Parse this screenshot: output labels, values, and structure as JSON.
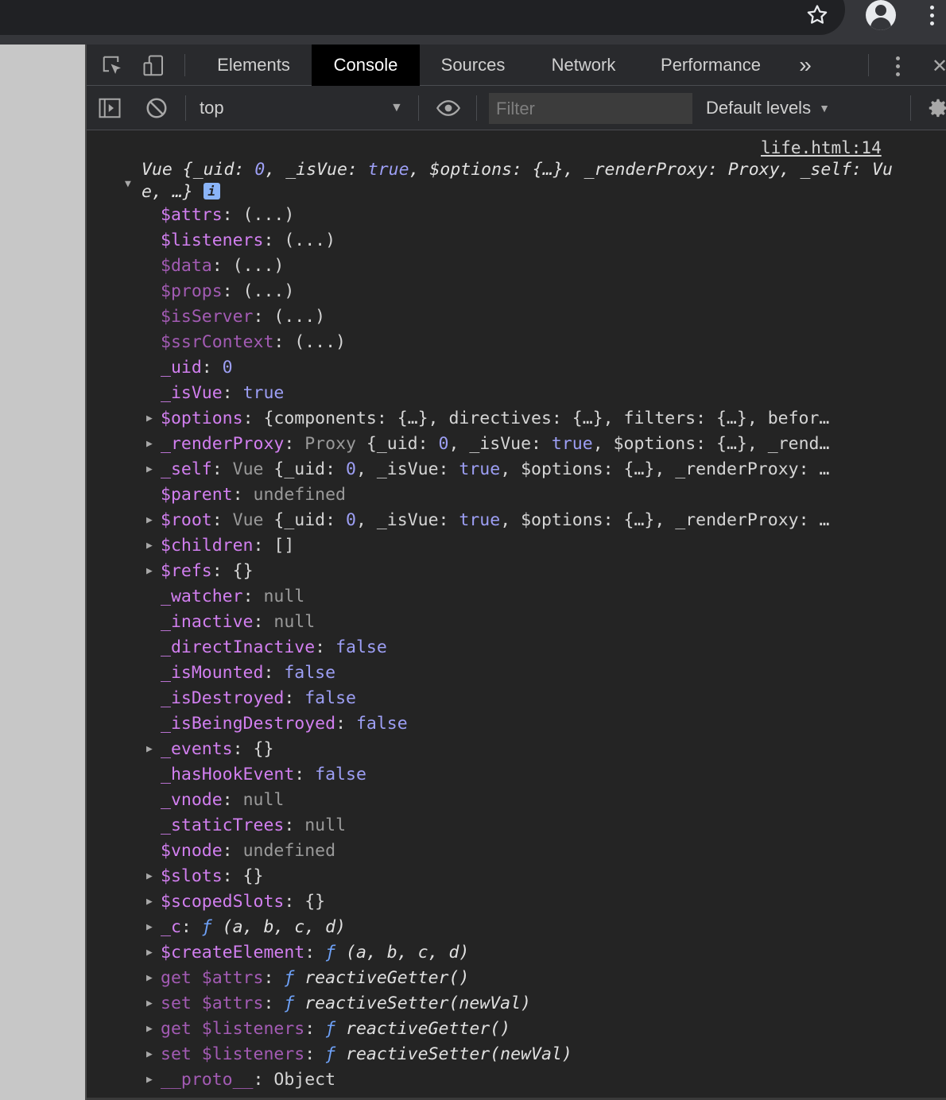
{
  "devtools": {
    "tabs": [
      {
        "label": "Elements",
        "selected": false
      },
      {
        "label": "Console",
        "selected": true
      },
      {
        "label": "Sources",
        "selected": false
      },
      {
        "label": "Network",
        "selected": false
      },
      {
        "label": "Performance",
        "selected": false
      }
    ],
    "more_tabs": "»",
    "close": "✕"
  },
  "toolbar": {
    "context": "top",
    "filter_placeholder": "Filter",
    "levels": "Default levels"
  },
  "console": {
    "source": "life.html:14",
    "summary": {
      "parts": [
        {
          "t": "Vue {_uid: ",
          "c": "fi"
        },
        {
          "t": "0",
          "c": "n"
        },
        {
          "t": ", _isVue: ",
          "c": "fi"
        },
        {
          "t": "true",
          "c": "b"
        },
        {
          "t": ", $options: {…}, _renderProxy: Proxy, _self: Vue, …}",
          "c": "fi"
        }
      ],
      "badge": "i"
    },
    "rows": [
      {
        "exp": false,
        "parts": [
          {
            "t": "$attrs",
            "c": "k"
          },
          {
            "t": ": (...)",
            "c": "c"
          }
        ]
      },
      {
        "exp": false,
        "parts": [
          {
            "t": "$listeners",
            "c": "k"
          },
          {
            "t": ": (...)",
            "c": "c"
          }
        ]
      },
      {
        "exp": false,
        "parts": [
          {
            "t": "$data",
            "c": "k dim"
          },
          {
            "t": ": (...)",
            "c": "c"
          }
        ]
      },
      {
        "exp": false,
        "parts": [
          {
            "t": "$props",
            "c": "k dim"
          },
          {
            "t": ": (...)",
            "c": "c"
          }
        ]
      },
      {
        "exp": false,
        "parts": [
          {
            "t": "$isServer",
            "c": "k dim"
          },
          {
            "t": ": (...)",
            "c": "c"
          }
        ]
      },
      {
        "exp": false,
        "parts": [
          {
            "t": "$ssrContext",
            "c": "k dim"
          },
          {
            "t": ": (...)",
            "c": "c"
          }
        ]
      },
      {
        "exp": false,
        "parts": [
          {
            "t": "_uid",
            "c": "k"
          },
          {
            "t": ": ",
            "c": "c"
          },
          {
            "t": "0",
            "c": "n"
          }
        ]
      },
      {
        "exp": false,
        "parts": [
          {
            "t": "_isVue",
            "c": "k"
          },
          {
            "t": ": ",
            "c": "c"
          },
          {
            "t": "true",
            "c": "b"
          }
        ]
      },
      {
        "exp": true,
        "parts": [
          {
            "t": "$options",
            "c": "k"
          },
          {
            "t": ": {components: {…}, directives: {…}, filters: {…}, befor…",
            "c": "c"
          }
        ]
      },
      {
        "exp": true,
        "parts": [
          {
            "t": "_renderProxy",
            "c": "k"
          },
          {
            "t": ": ",
            "c": "c"
          },
          {
            "t": "Proxy ",
            "c": "g"
          },
          {
            "t": "{_uid: ",
            "c": "c"
          },
          {
            "t": "0",
            "c": "n"
          },
          {
            "t": ", _isVue: ",
            "c": "c"
          },
          {
            "t": "true",
            "c": "b"
          },
          {
            "t": ", $options: {…}, _rend…",
            "c": "c"
          }
        ]
      },
      {
        "exp": true,
        "parts": [
          {
            "t": "_self",
            "c": "k"
          },
          {
            "t": ": ",
            "c": "c"
          },
          {
            "t": "Vue ",
            "c": "g"
          },
          {
            "t": "{_uid: ",
            "c": "c"
          },
          {
            "t": "0",
            "c": "n"
          },
          {
            "t": ", _isVue: ",
            "c": "c"
          },
          {
            "t": "true",
            "c": "b"
          },
          {
            "t": ", $options: {…}, _renderProxy: …",
            "c": "c"
          }
        ]
      },
      {
        "exp": false,
        "parts": [
          {
            "t": "$parent",
            "c": "k"
          },
          {
            "t": ": ",
            "c": "c"
          },
          {
            "t": "undefined",
            "c": "nl"
          }
        ]
      },
      {
        "exp": true,
        "parts": [
          {
            "t": "$root",
            "c": "k"
          },
          {
            "t": ": ",
            "c": "c"
          },
          {
            "t": "Vue ",
            "c": "g"
          },
          {
            "t": "{_uid: ",
            "c": "c"
          },
          {
            "t": "0",
            "c": "n"
          },
          {
            "t": ", _isVue: ",
            "c": "c"
          },
          {
            "t": "true",
            "c": "b"
          },
          {
            "t": ", $options: {…}, _renderProxy: …",
            "c": "c"
          }
        ]
      },
      {
        "exp": true,
        "parts": [
          {
            "t": "$children",
            "c": "k"
          },
          {
            "t": ": []",
            "c": "c"
          }
        ]
      },
      {
        "exp": true,
        "parts": [
          {
            "t": "$refs",
            "c": "k"
          },
          {
            "t": ": {}",
            "c": "c"
          }
        ]
      },
      {
        "exp": false,
        "parts": [
          {
            "t": "_watcher",
            "c": "k"
          },
          {
            "t": ": ",
            "c": "c"
          },
          {
            "t": "null",
            "c": "nl"
          }
        ]
      },
      {
        "exp": false,
        "parts": [
          {
            "t": "_inactive",
            "c": "k"
          },
          {
            "t": ": ",
            "c": "c"
          },
          {
            "t": "null",
            "c": "nl"
          }
        ]
      },
      {
        "exp": false,
        "parts": [
          {
            "t": "_directInactive",
            "c": "k"
          },
          {
            "t": ": ",
            "c": "c"
          },
          {
            "t": "false",
            "c": "b"
          }
        ]
      },
      {
        "exp": false,
        "parts": [
          {
            "t": "_isMounted",
            "c": "k"
          },
          {
            "t": ": ",
            "c": "c"
          },
          {
            "t": "false",
            "c": "b"
          }
        ]
      },
      {
        "exp": false,
        "parts": [
          {
            "t": "_isDestroyed",
            "c": "k"
          },
          {
            "t": ": ",
            "c": "c"
          },
          {
            "t": "false",
            "c": "b"
          }
        ]
      },
      {
        "exp": false,
        "parts": [
          {
            "t": "_isBeingDestroyed",
            "c": "k"
          },
          {
            "t": ": ",
            "c": "c"
          },
          {
            "t": "false",
            "c": "b"
          }
        ]
      },
      {
        "exp": true,
        "parts": [
          {
            "t": "_events",
            "c": "k"
          },
          {
            "t": ": {}",
            "c": "c"
          }
        ]
      },
      {
        "exp": false,
        "parts": [
          {
            "t": "_hasHookEvent",
            "c": "k"
          },
          {
            "t": ": ",
            "c": "c"
          },
          {
            "t": "false",
            "c": "b"
          }
        ]
      },
      {
        "exp": false,
        "parts": [
          {
            "t": "_vnode",
            "c": "k"
          },
          {
            "t": ": ",
            "c": "c"
          },
          {
            "t": "null",
            "c": "nl"
          }
        ]
      },
      {
        "exp": false,
        "parts": [
          {
            "t": "_staticTrees",
            "c": "k"
          },
          {
            "t": ": ",
            "c": "c"
          },
          {
            "t": "null",
            "c": "nl"
          }
        ]
      },
      {
        "exp": false,
        "parts": [
          {
            "t": "$vnode",
            "c": "k"
          },
          {
            "t": ": ",
            "c": "c"
          },
          {
            "t": "undefined",
            "c": "nl"
          }
        ]
      },
      {
        "exp": true,
        "parts": [
          {
            "t": "$slots",
            "c": "k"
          },
          {
            "t": ": {}",
            "c": "c"
          }
        ]
      },
      {
        "exp": true,
        "parts": [
          {
            "t": "$scopedSlots",
            "c": "k"
          },
          {
            "t": ": {}",
            "c": "c"
          }
        ]
      },
      {
        "exp": true,
        "parts": [
          {
            "t": "_c",
            "c": "k"
          },
          {
            "t": ": ",
            "c": "c"
          },
          {
            "t": "ƒ ",
            "c": "f"
          },
          {
            "t": "(a, b, c, d)",
            "c": "fi"
          }
        ]
      },
      {
        "exp": true,
        "parts": [
          {
            "t": "$createElement",
            "c": "k"
          },
          {
            "t": ": ",
            "c": "c"
          },
          {
            "t": "ƒ ",
            "c": "f"
          },
          {
            "t": "(a, b, c, d)",
            "c": "fi"
          }
        ]
      },
      {
        "exp": true,
        "parts": [
          {
            "t": "get $attrs",
            "c": "k dim"
          },
          {
            "t": ": ",
            "c": "c"
          },
          {
            "t": "ƒ ",
            "c": "f"
          },
          {
            "t": "reactiveGetter()",
            "c": "fi"
          }
        ]
      },
      {
        "exp": true,
        "parts": [
          {
            "t": "set $attrs",
            "c": "k dim"
          },
          {
            "t": ": ",
            "c": "c"
          },
          {
            "t": "ƒ ",
            "c": "f"
          },
          {
            "t": "reactiveSetter(newVal)",
            "c": "fi"
          }
        ]
      },
      {
        "exp": true,
        "parts": [
          {
            "t": "get $listeners",
            "c": "k dim"
          },
          {
            "t": ": ",
            "c": "c"
          },
          {
            "t": "ƒ ",
            "c": "f"
          },
          {
            "t": "reactiveGetter()",
            "c": "fi"
          }
        ]
      },
      {
        "exp": true,
        "parts": [
          {
            "t": "set $listeners",
            "c": "k dim"
          },
          {
            "t": ": ",
            "c": "c"
          },
          {
            "t": "ƒ ",
            "c": "f"
          },
          {
            "t": "reactiveSetter(newVal)",
            "c": "fi"
          }
        ]
      },
      {
        "exp": true,
        "parts": [
          {
            "t": "__proto__",
            "c": "k dim"
          },
          {
            "t": ": Object",
            "c": "c"
          }
        ]
      }
    ]
  }
}
